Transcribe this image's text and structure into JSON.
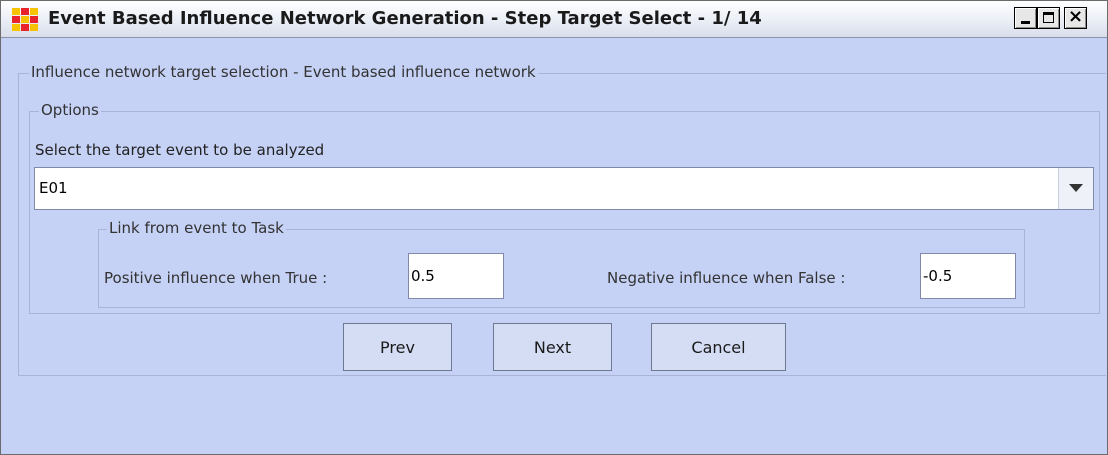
{
  "window": {
    "title": "Event Based Influence Network Generation - Step Target Select - 1/ 14",
    "icon": "ora-grid-icon",
    "controls": {
      "minimize": "minimize-icon",
      "maximize": "maximize-icon",
      "close": "close-icon",
      "close_glyph": "×"
    }
  },
  "panel": {
    "caption": "Influence network target selection - Event based influence network",
    "options": {
      "caption": "Options",
      "select_label": "Select the target event to be analyzed",
      "select_value": "E01"
    },
    "link": {
      "caption": "Link from event to Task",
      "positive_label": "Positive influence when True :",
      "positive_value": "0.5",
      "negative_label": "Negative influence when False :",
      "negative_value": "-0.5"
    }
  },
  "buttons": {
    "prev": "Prev",
    "next": "Next",
    "cancel": "Cancel"
  },
  "colors": {
    "background": "#c5d1f5",
    "button": "#d5ddf5",
    "icon_red": "#e8232b",
    "icon_yellow": "#f7c300"
  }
}
